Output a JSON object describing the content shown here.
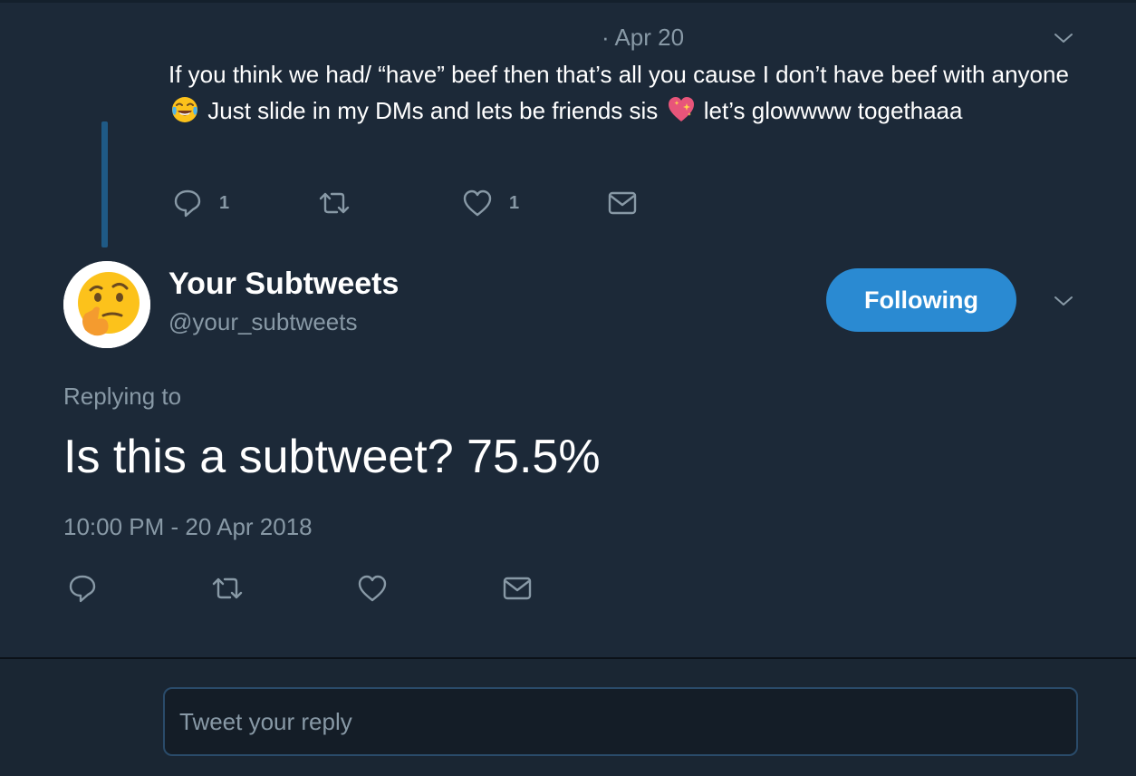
{
  "parent_tweet": {
    "date": "· Apr 20",
    "text_part1": "If you think we had/ “have” beef then that’s all you cause I don’t have beef with anyone",
    "text_part2": "Just slide in my DMs and lets be friends sis",
    "text_part3": "let’s glowwww togethaaa",
    "emoji_1": "face-with-tears-of-joy",
    "emoji_2": "sparkling-heart",
    "reply_count": "1",
    "like_count": "1"
  },
  "main_tweet": {
    "display_name": "Your Subtweets",
    "handle": "@your_subtweets",
    "avatar_icon": "thinking-face",
    "follow_label": "Following",
    "replying_to": "Replying to",
    "text": "Is this a subtweet? 75.5%",
    "timestamp": "10:00 PM - 20 Apr 2018"
  },
  "reply_box": {
    "placeholder": "Tweet your reply"
  },
  "colors": {
    "background": "#1c2938",
    "accent": "#2a8ad2",
    "muted_text": "#8899a6",
    "thread_line": "#1f5a86"
  }
}
